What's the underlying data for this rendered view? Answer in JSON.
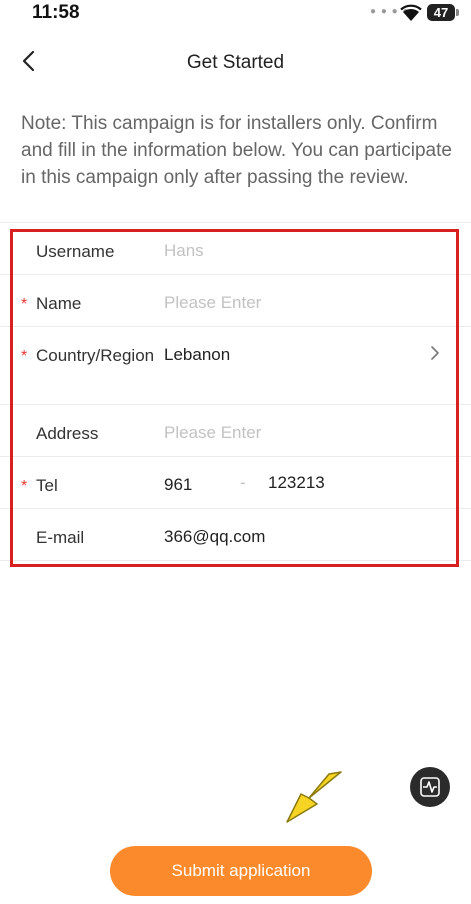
{
  "status": {
    "time": "11:58",
    "battery": "47"
  },
  "header": {
    "title": "Get Started"
  },
  "note": "Note: This campaign is for installers only. Confirm and fill in the information below. You can participate in this campaign only after passing the review.",
  "form": {
    "username": {
      "label": "Username",
      "value": "Hans"
    },
    "name": {
      "label": "Name",
      "placeholder": "Please Enter"
    },
    "country": {
      "label": "Country/Region",
      "value": "Lebanon"
    },
    "address": {
      "label": "Address",
      "placeholder": "Please Enter"
    },
    "tel": {
      "label": "Tel",
      "code": "961",
      "separator": "-",
      "number": "123213"
    },
    "email": {
      "label": "E-mail",
      "value": "366@qq.com"
    }
  },
  "submit_label": "Submit application",
  "colors": {
    "accent": "#fb8a2d",
    "required": "#e53935",
    "highlight": "#d92020"
  }
}
